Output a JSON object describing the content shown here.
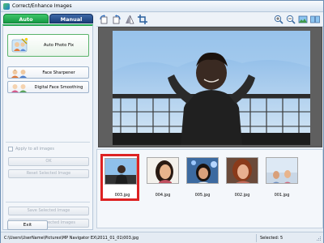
{
  "window": {
    "title": "Correct/Enhance Images"
  },
  "tabs": {
    "auto": "Auto",
    "manual": "Manual"
  },
  "features": [
    {
      "label": "Auto Photo Fix",
      "icon": "auto-photo-fix-icon",
      "active": true
    },
    {
      "label": "Face Sharpener",
      "icon": "face-sharpener-icon",
      "active": false
    },
    {
      "label": "Digital Face Smoothing",
      "icon": "face-smoothing-icon",
      "active": false
    }
  ],
  "controls": {
    "apply_all_label": "Apply to all images",
    "apply_all_checked": false,
    "ok_label": "OK",
    "reset_label": "Reset Selected Image",
    "save_selected_label": "Save Selected Image",
    "save_all_label": "Save All Corrected Images",
    "exit_label": "Exit"
  },
  "toolbar": {
    "icons": [
      "rotate-left-icon",
      "rotate-right-icon",
      "flip-icon",
      "crop-icon",
      "zoom-in-icon",
      "zoom-out-icon",
      "full-image-icon",
      "compare-icon"
    ]
  },
  "thumbnails": [
    {
      "filename": "003.jpg",
      "selected": true
    },
    {
      "filename": "004.jpg",
      "selected": false
    },
    {
      "filename": "005.jpg",
      "selected": false
    },
    {
      "filename": "002.jpg",
      "selected": false
    },
    {
      "filename": "001.jpg",
      "selected": false
    }
  ],
  "status": {
    "path": "C:\\Users\\UserName\\Pictures\\MP Navigator EX\\2011_01_01\\003.jpg",
    "selected": "Selected: 5"
  },
  "colors": {
    "auto_tab": "#21a650",
    "manual_tab": "#1b3f7a",
    "selection_border": "#dd2222",
    "preview_bg": "#5f5f5f"
  }
}
